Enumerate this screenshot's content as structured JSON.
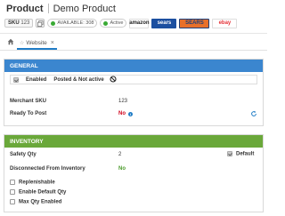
{
  "header": {
    "title": "Product",
    "product_name": "Demo Product",
    "sku_label": "SKU",
    "sku_value": "123",
    "available_text": "AVAILABLE: 308",
    "status_text": "Active",
    "channels": [
      {
        "name": "amazon",
        "bg": "#ffffff",
        "color": "#222222"
      },
      {
        "name": "sears",
        "bg": "#1c4fa0",
        "color": "#ffffff"
      },
      {
        "name": "SEARS",
        "bg": "#e8702a",
        "color": "#1c3f7a"
      },
      {
        "name": "ebay",
        "bg": "#ffffff",
        "color": "#e53238"
      }
    ]
  },
  "tabs": {
    "home_icon": "home-icon",
    "items": [
      {
        "label": "Website"
      }
    ]
  },
  "general": {
    "title": "GENERAL",
    "color": "#3b86cf",
    "enabled_label": "Enabled",
    "enabled_status": "Posted & Not active",
    "merchant_sku_label": "Merchant SKU",
    "merchant_sku_value": "123",
    "ready_to_post_label": "Ready To Post",
    "ready_to_post_value": "No"
  },
  "inventory": {
    "title": "INVENTORY",
    "color": "#6aa83a",
    "safety_qty_label": "Safety Qty",
    "safety_qty_value": "2",
    "default_label": "Default",
    "disconnected_label": "Disconnected From Inventory",
    "disconnected_value": "No",
    "checkboxes": [
      {
        "label": "Replenishable"
      },
      {
        "label": "Enable Default Qty"
      },
      {
        "label": "Max Qty Enabled"
      }
    ]
  },
  "colors": {
    "accent": "#1f7cc6",
    "no_red": "#d0021b",
    "no_green": "#4a9a2a",
    "available_green": "#3aaa35",
    "active_green": "#3aaa35"
  }
}
